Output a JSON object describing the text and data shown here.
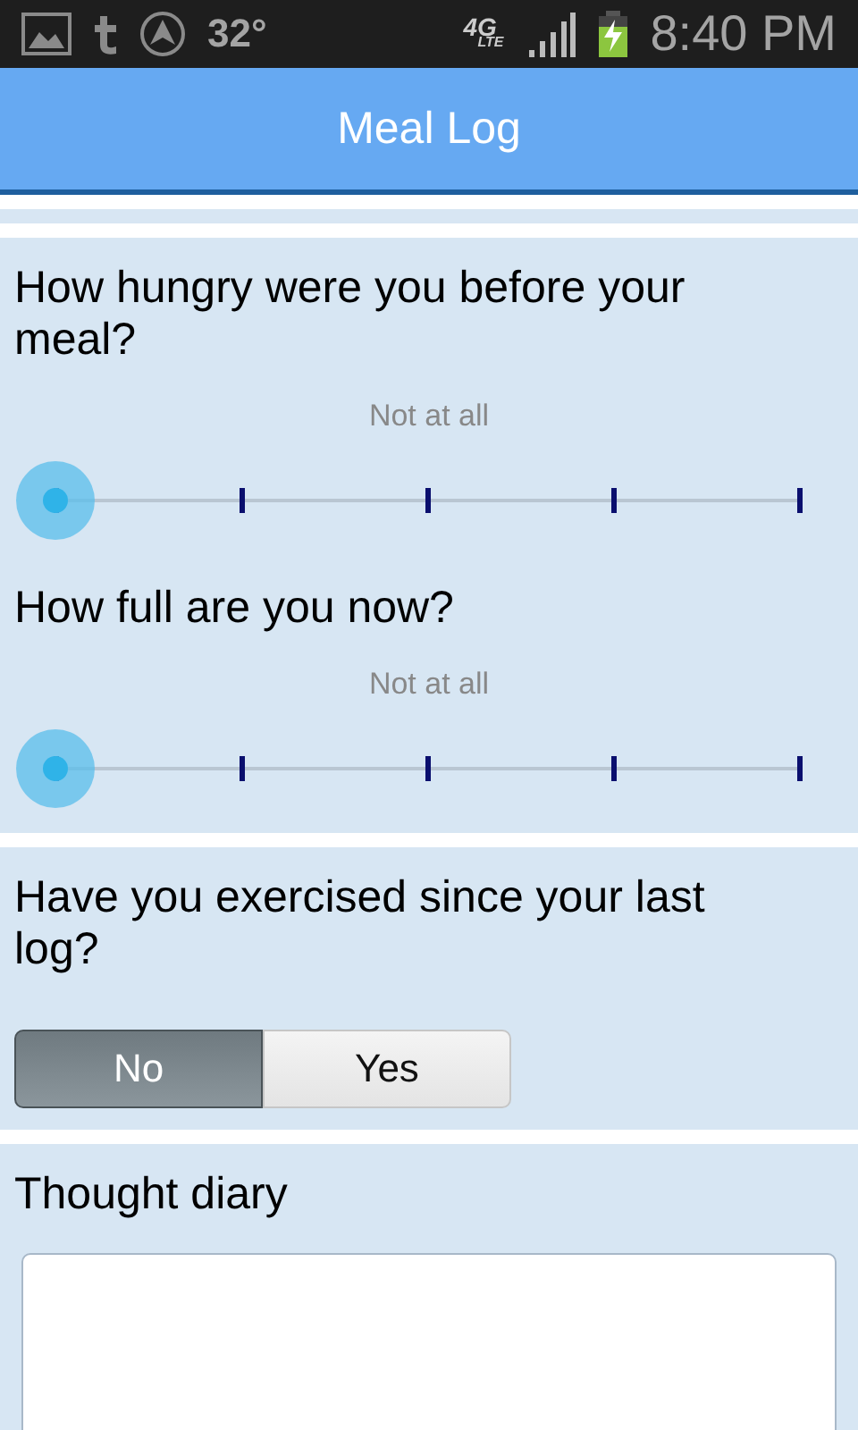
{
  "status_bar": {
    "temperature": "32°",
    "network": "4G",
    "network_sub": "LTE",
    "time": "8:40 PM",
    "battery_charging": true
  },
  "header": {
    "title": "Meal Log"
  },
  "sliders": [
    {
      "question": "How hungry were you before your meal?",
      "value_label": "Not at all"
    },
    {
      "question": "How full are you now?",
      "value_label": "Not at all"
    }
  ],
  "exercise": {
    "question": "Have you exercised since your last log?",
    "options": [
      {
        "label": "No",
        "selected": true
      },
      {
        "label": "Yes",
        "selected": false
      }
    ]
  },
  "diary": {
    "title": "Thought diary"
  }
}
